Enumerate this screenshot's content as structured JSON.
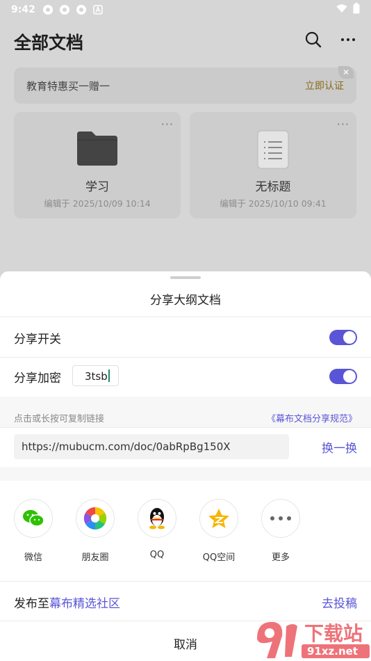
{
  "status_bar": {
    "time": "9:42"
  },
  "header": {
    "title": "全部文档"
  },
  "promo": {
    "text": "教育特惠买一赠一",
    "action": "立即认证"
  },
  "cards": [
    {
      "name": "学习",
      "meta": "编辑于 2025/10/09 10:14",
      "thumb_icon": "folder-icon"
    },
    {
      "name": "无标题",
      "meta": "编辑于 2025/10/10 09:41",
      "thumb_icon": "document-icon"
    }
  ],
  "sheet": {
    "title": "分享大纲文档",
    "share_switch_label": "分享开关",
    "share_switch_on": true,
    "encrypt_label": "分享加密",
    "encrypt_on": true,
    "password_value": "3tsb",
    "hint": "点击或长按可复制链接",
    "spec_link": "《幕布文档分享规范》",
    "url": "https://mubucm.com/doc/0abRpBg150X",
    "swap_label": "换一换",
    "share_targets": [
      {
        "label": "微信",
        "icon": "wechat-icon"
      },
      {
        "label": "朋友圈",
        "icon": "moments-icon"
      },
      {
        "label": "QQ",
        "icon": "qq-icon"
      },
      {
        "label": "QQ空间",
        "icon": "qzone-icon"
      },
      {
        "label": "更多",
        "icon": "more-icon"
      }
    ],
    "publish_prefix": "发布至",
    "publish_community": "幕布精选社区",
    "submit_label": "去投稿",
    "cancel_label": "取消"
  },
  "watermark": {
    "text_cn": "下载站",
    "text_url": "91xz.net",
    "logo": "9f"
  },
  "colors": {
    "accent": "#5a55d6",
    "promo_action": "#8a6a1a",
    "overlay": "#d6d6d6"
  }
}
